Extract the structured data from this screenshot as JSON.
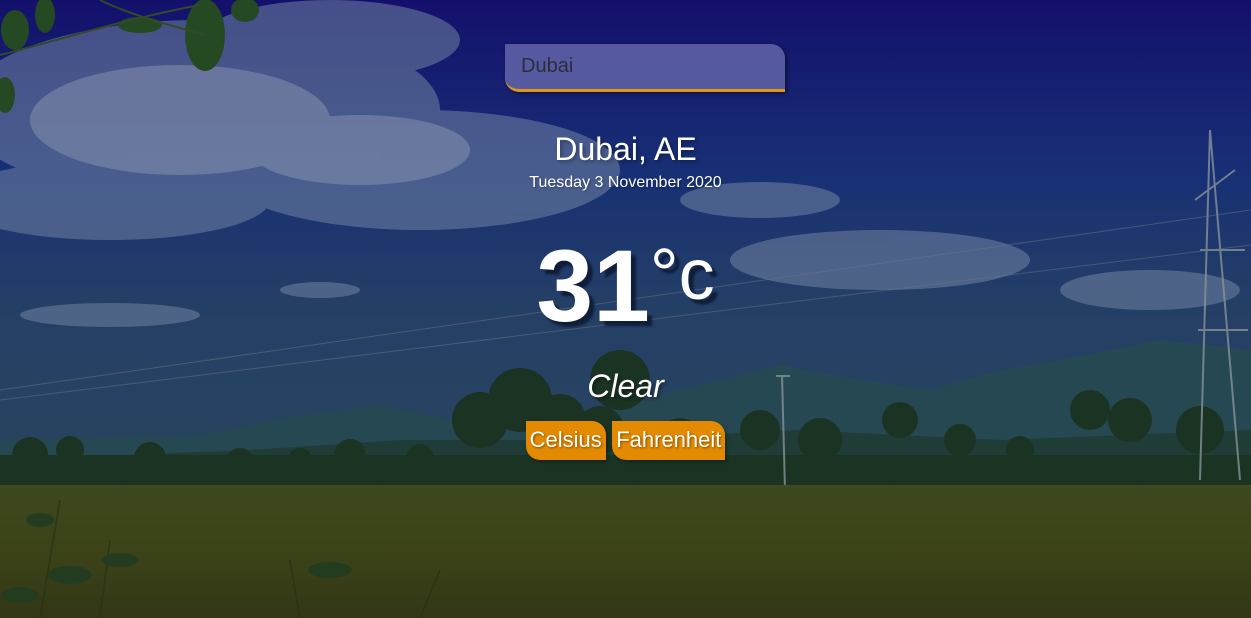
{
  "search": {
    "value": "Dubai"
  },
  "location": {
    "name": "Dubai, AE",
    "date": "Tuesday 3 November 2020"
  },
  "weather": {
    "temperature": "31",
    "unit": "°c",
    "condition": "Clear"
  },
  "unit_buttons": {
    "celsius_label": "Celsius",
    "fahrenheit_label": "Fahrenheit"
  },
  "colors": {
    "accent": "#e48a00",
    "sky": "#1b1f8a",
    "field": "#4c5016"
  }
}
